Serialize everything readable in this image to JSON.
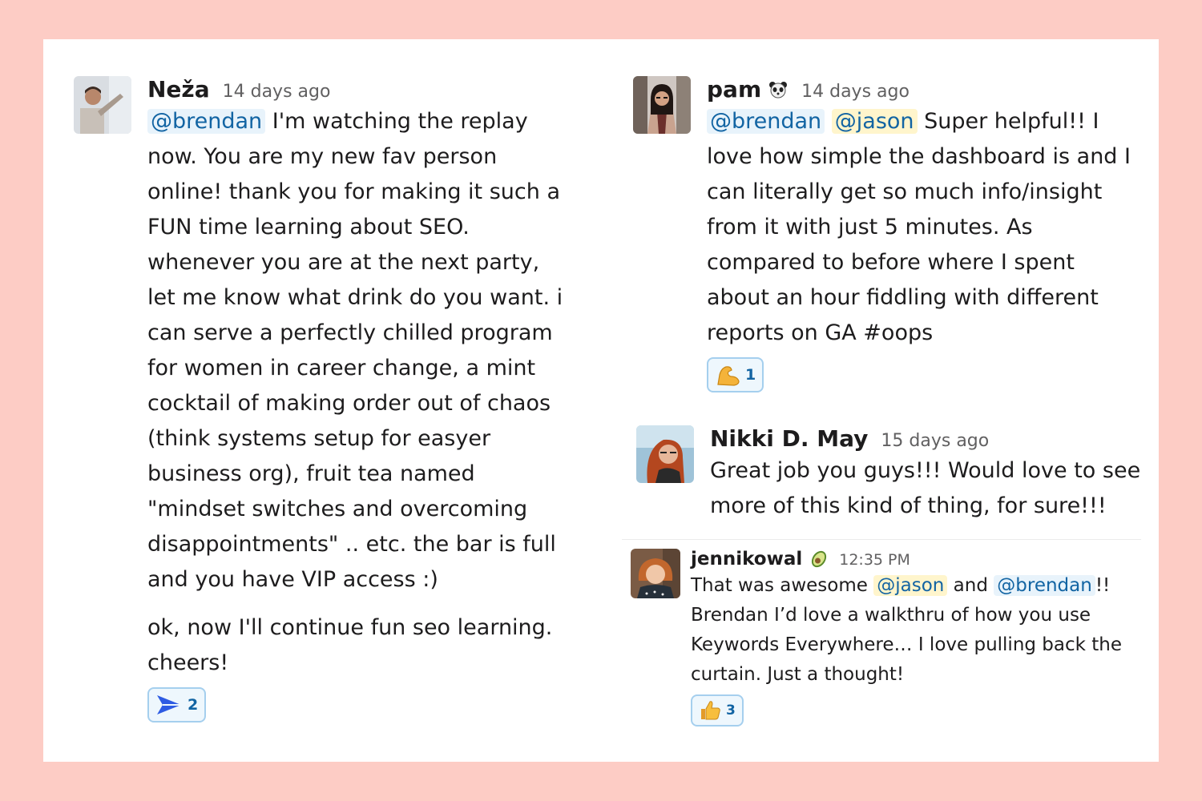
{
  "messages": [
    {
      "author": "Neža",
      "timestamp": "14 days ago",
      "paragraphs": [
        {
          "mention": "@brendan",
          "text": " I'm watching the replay now. You are my new fav person online! thank you for making it such a FUN time learning about SEO. whenever you are at the next party, let me know what drink do you want. i can serve a perfectly chilled program for women in career change, a mint cocktail of making order out of chaos (think systems setup for easyer business org), fruit tea named \"mindset switches and overcoming disappointments\" .. etc. the bar is full and you have VIP access :)"
        },
        {
          "text": "ok, now I'll continue fun seo learning. cheers!"
        }
      ],
      "reaction": {
        "icon": "paper-plane-icon",
        "count": "2"
      }
    },
    {
      "author": "pam",
      "status_icon": "panda-icon",
      "timestamp": "14 days ago",
      "mention_1": "@brendan",
      "mention_2": "@jason",
      "text": " Super helpful!! I love how simple the dashboard is and I can literally get so much info/insight from it with just 5 minutes. As compared to before where I spent about an hour fiddling with different reports on GA #oops",
      "reaction": {
        "icon": "flexed-biceps-icon",
        "count": "1"
      }
    },
    {
      "author": "Nikki D. May",
      "timestamp": "15 days ago",
      "text": "Great job you guys!!! Would love to see more of this kind of thing, for sure!!!"
    },
    {
      "author": "jennikowal",
      "status_icon": "avocado-icon",
      "timestamp": "12:35 PM",
      "text_1": "That was awesome ",
      "mention_1": "@jason",
      "text_2": " and ",
      "mention_2": "@brendan",
      "text_3": "!! Brendan I’d love a walkthru of how you use Keywords Everywhere… I love pulling back the curtain. Just a thought!",
      "reaction": {
        "icon": "thumbs-up-icon",
        "count": "3"
      }
    }
  ],
  "colors": {
    "page_background": "#fdccc5",
    "card_background": "#ffffff",
    "mention_text": "#1264a3",
    "mention_background": "#e8f3fb",
    "self_mention_background": "#fff5cc",
    "reaction_border": "#a5cfee"
  }
}
